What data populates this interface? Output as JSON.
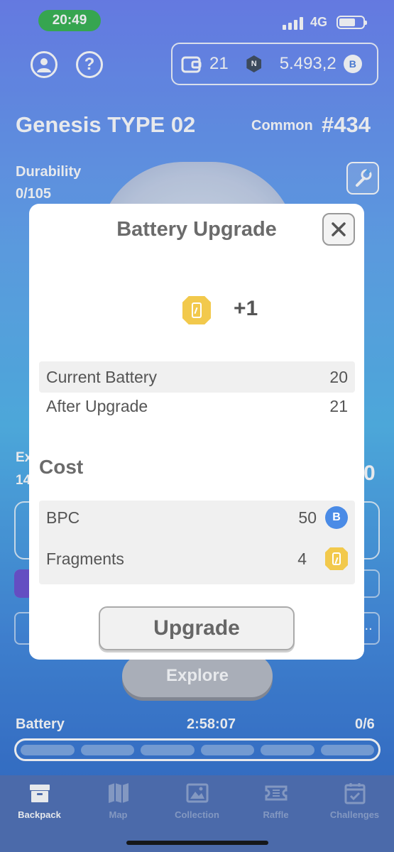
{
  "status": {
    "time": "20:49",
    "network": "4G"
  },
  "wallet": {
    "count": "21",
    "balance": "5.493,2",
    "n_badge": "N",
    "coin": "B"
  },
  "header": {
    "title": "Genesis TYPE 02",
    "rarity": "Common",
    "serial": "#434"
  },
  "durability": {
    "label": "Durability",
    "value": "0/105"
  },
  "background": {
    "ex": "Ex",
    "num": "14",
    "right_digit": "0",
    "dots": "..."
  },
  "explore_label": "Explore",
  "battery_bar": {
    "label": "Battery",
    "timer": "2:58:07",
    "count": "0/6",
    "fill_fraction": 0
  },
  "tabs": [
    {
      "label": "Backpack",
      "icon": "backpack-icon"
    },
    {
      "label": "Map",
      "icon": "map-icon"
    },
    {
      "label": "Collection",
      "icon": "collection-icon"
    },
    {
      "label": "Raffle",
      "icon": "raffle-icon"
    },
    {
      "label": "Challenges",
      "icon": "challenges-icon"
    }
  ],
  "modal": {
    "title": "Battery Upgrade",
    "increase": "+1",
    "current_label": "Current Battery",
    "current_value": "20",
    "after_label": "After Upgrade",
    "after_value": "21",
    "cost_title": "Cost",
    "bpc_label": "BPC",
    "bpc_value": "50",
    "bpc_coin": "B",
    "fragments_label": "Fragments",
    "fragments_value": "4",
    "upgrade_label": "Upgrade"
  },
  "colors": {
    "active_tab": "#ffffff",
    "inactive_tab": "#8ea3cf",
    "fragment": "#f2c94c",
    "coin_blue": "#4a8be6",
    "status_green": "#36b24e"
  }
}
